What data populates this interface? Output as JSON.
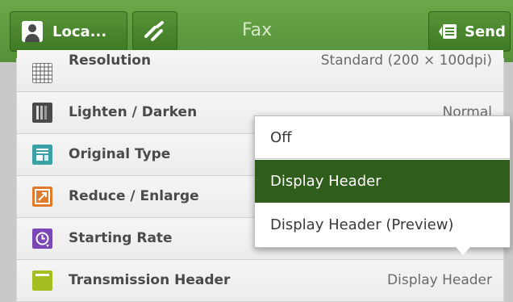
{
  "header": {
    "title": "Fax",
    "login_label": "Loca...",
    "send_label": "Send",
    "bar_color": "#5e9a3e"
  },
  "settings": [
    {
      "label": "Resolution",
      "value": "Standard (200 × 100dpi)",
      "icon": "resolution-icon"
    },
    {
      "label": "Lighten / Darken",
      "value": "Normal",
      "icon": "lighten-darken-icon"
    },
    {
      "label": "Original Type",
      "value": "",
      "icon": "original-type-icon"
    },
    {
      "label": "Reduce / Enlarge",
      "value": "",
      "icon": "reduce-enlarge-icon"
    },
    {
      "label": "Starting Rate",
      "value": "",
      "icon": "starting-rate-icon"
    },
    {
      "label": "Transmission Header",
      "value": "Display Header",
      "icon": "transmission-header-icon"
    }
  ],
  "dropdown": {
    "options": [
      "Off",
      "Display Header",
      "Display Header (Preview)"
    ],
    "selected": "Display Header",
    "selected_color": "#2f5e1c"
  }
}
